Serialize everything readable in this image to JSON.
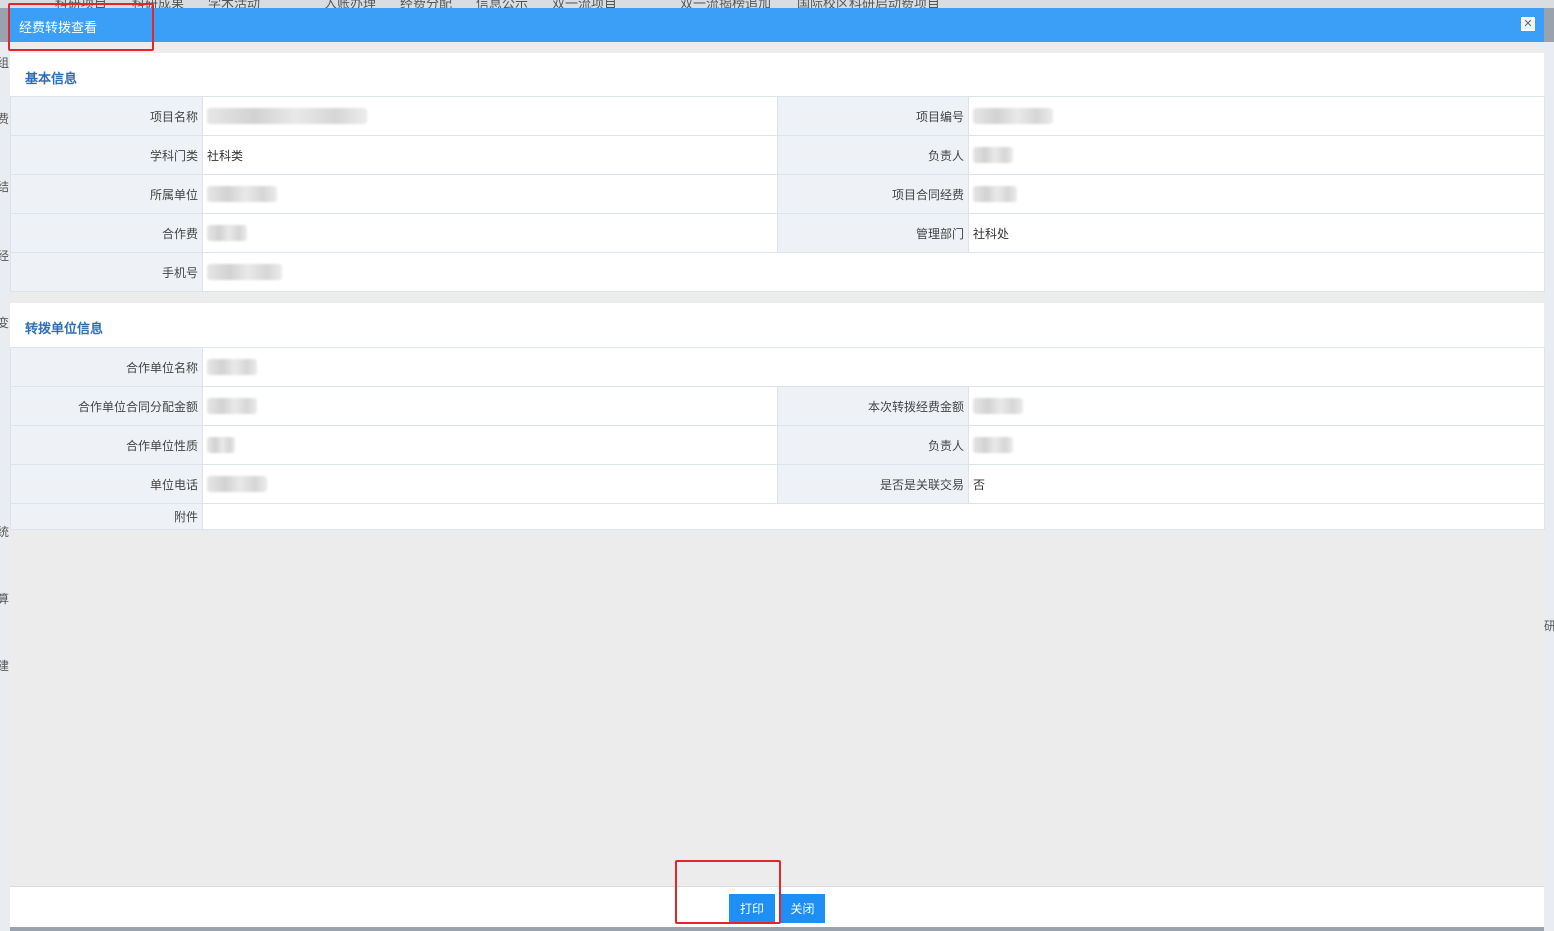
{
  "background_nav": [
    "科研项目",
    "科研成果",
    "学术活动",
    "入账办理",
    "经费分配",
    "信息公示",
    "双一流项目",
    "双一流揭榜追加",
    "国际校区科研启动费项目"
  ],
  "background_left_chars": [
    "组",
    "费",
    "结",
    "经",
    "变",
    "统",
    "算",
    "建"
  ],
  "background_right_chars": [
    "研"
  ],
  "dialog": {
    "title": "经费转拨查看",
    "close_glyph": "✕"
  },
  "basic_info": {
    "title": "基本信息",
    "fields": {
      "project_name": {
        "label": "项目名称",
        "value": ""
      },
      "project_number": {
        "label": "项目编号",
        "value": ""
      },
      "discipline": {
        "label": "学科门类",
        "value": "社科类"
      },
      "leader": {
        "label": "负责人",
        "value": ""
      },
      "unit": {
        "label": "所属单位",
        "value": ""
      },
      "contract_funds": {
        "label": "项目合同经费",
        "value": ""
      },
      "coop_funds": {
        "label": "合作费",
        "value": ""
      },
      "dept": {
        "label": "管理部门",
        "value": "社科处"
      },
      "phone": {
        "label": "手机号",
        "value": ""
      }
    }
  },
  "transfer_info": {
    "title": "转拨单位信息",
    "fields": {
      "coop_unit_name": {
        "label": "合作单位名称",
        "value": ""
      },
      "coop_contract_amount": {
        "label": "合作单位合同分配金额",
        "value": ""
      },
      "this_transfer_amount": {
        "label": "本次转拨经费金额",
        "value": ""
      },
      "coop_unit_nature": {
        "label": "合作单位性质",
        "value": ""
      },
      "leader": {
        "label": "负责人",
        "value": ""
      },
      "unit_phone": {
        "label": "单位电话",
        "value": ""
      },
      "related_transaction": {
        "label": "是否是关联交易",
        "value": "否"
      },
      "attachment": {
        "label": "附件",
        "value": ""
      }
    }
  },
  "buttons": {
    "print": "打印",
    "close": "关闭"
  },
  "colors": {
    "titlebar": "#3b9ff7",
    "button": "#1e8ff5",
    "section_title": "#2e6fb5",
    "highlight_box": "#e3262c"
  }
}
